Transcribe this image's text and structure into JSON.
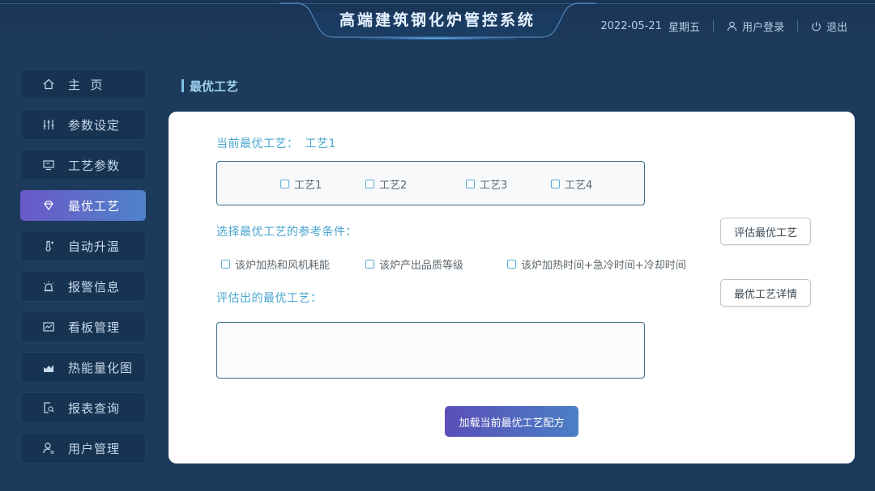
{
  "header": {
    "title": "高端建筑钢化炉管控系统",
    "date": "2022-05-21",
    "weekday": "星期五",
    "login_label": "用户登录",
    "logout_label": "退出"
  },
  "sidebar": {
    "items": [
      {
        "label": "主  页",
        "icon": "home-icon"
      },
      {
        "label": "参数设定",
        "icon": "sliders-icon"
      },
      {
        "label": "工艺参数",
        "icon": "monitor-icon"
      },
      {
        "label": "最优工艺",
        "icon": "diamond-icon",
        "active": true
      },
      {
        "label": "自动升温",
        "icon": "thermometer-icon"
      },
      {
        "label": "报警信息",
        "icon": "alarm-icon"
      },
      {
        "label": "看板管理",
        "icon": "chart-board-icon"
      },
      {
        "label": "热能量化图",
        "icon": "area-chart-icon"
      },
      {
        "label": "报表查询",
        "icon": "report-search-icon"
      },
      {
        "label": "用户管理",
        "icon": "user-manage-icon"
      }
    ]
  },
  "page": {
    "title": "最优工艺"
  },
  "main": {
    "current_label": "当前最优工艺：",
    "current_value": "工艺1",
    "processes": [
      "工艺1",
      "工艺2",
      "工艺3",
      "工艺4"
    ],
    "conditions_label": "选择最优工艺的参考条件：",
    "conditions": [
      "该炉加热和风机耗能",
      "该炉产出品质等级",
      "该炉加热时间+急冷时间+冷却时间"
    ],
    "evaluated_label": "评估出的最优工艺：",
    "evaluated_value": "",
    "evaluate_button": "评估最优工艺",
    "detail_button": "最优工艺详情",
    "load_button": "加载当前最优工艺配方"
  },
  "colors": {
    "background": "#1c3a5c",
    "accent": "#4aa6cf",
    "active_nav_start": "#6a59c8",
    "active_nav_end": "#4f82c9"
  }
}
